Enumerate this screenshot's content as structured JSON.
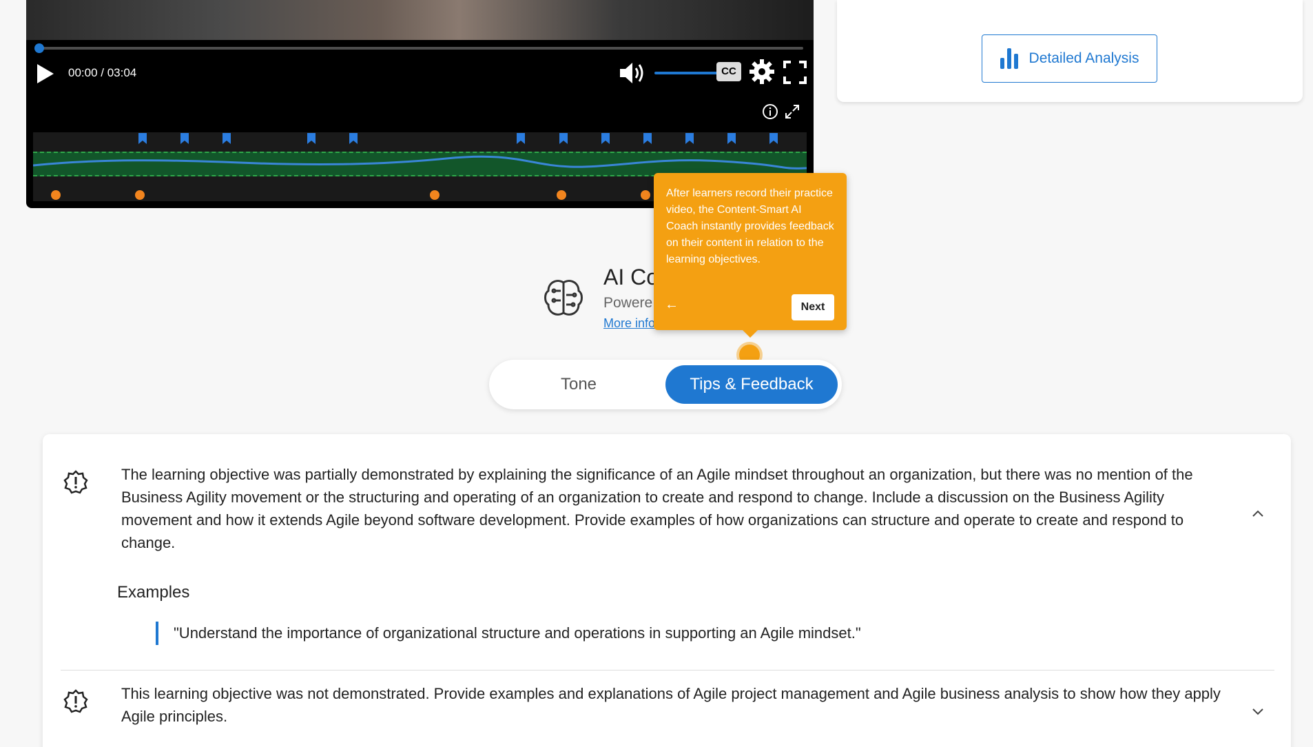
{
  "player": {
    "time": "00:00 / 03:04",
    "cc_label": "CC",
    "icons": {
      "play": "play-icon",
      "volume": "volume-icon",
      "settings": "gear-icon",
      "fullscreen": "fullscreen-icon",
      "info": "info-icon",
      "expand": "expand-icon"
    },
    "progress": 0,
    "volume_level": 1.0,
    "colors": {
      "accent": "#1f78d1",
      "marker": "#f2851e",
      "wave_band": "#12562a"
    }
  },
  "right_card": {
    "button_label": "Detailed Analysis",
    "button_icon": "bar-chart-icon"
  },
  "coach": {
    "title": "AI Co",
    "subtitle": "Powere",
    "link": "More info",
    "icon": "brain-icon"
  },
  "tooltip": {
    "text": "After learners record their practice video, the Content-Smart AI Coach instantly provides feedback on their content in relation to the learning objectives.",
    "back_label": "←",
    "next_label": "Next",
    "color": "#f4a012"
  },
  "tabs": {
    "tone": "Tone",
    "tips": "Tips & Feedback",
    "active": "Tips & Feedback"
  },
  "feedback": {
    "items": [
      {
        "text": "The learning objective was partially demonstrated by explaining the significance of an Agile mindset throughout an organization, but there was no mention of the Business Agility movement or the structuring and operating of an organization to create and respond to change. Include a discussion on the Business Agility movement and how it extends Agile beyond software development. Provide examples of how organizations can structure and operate to create and respond to change.",
        "expanded": true,
        "examples_label": "Examples",
        "example": "\"Understand the importance of organizational structure and operations in supporting an Agile mindset.\""
      },
      {
        "text": "This learning objective was not demonstrated. Provide examples and explanations of Agile project management and Agile business analysis to show how they apply Agile principles.",
        "expanded": false
      }
    ]
  }
}
